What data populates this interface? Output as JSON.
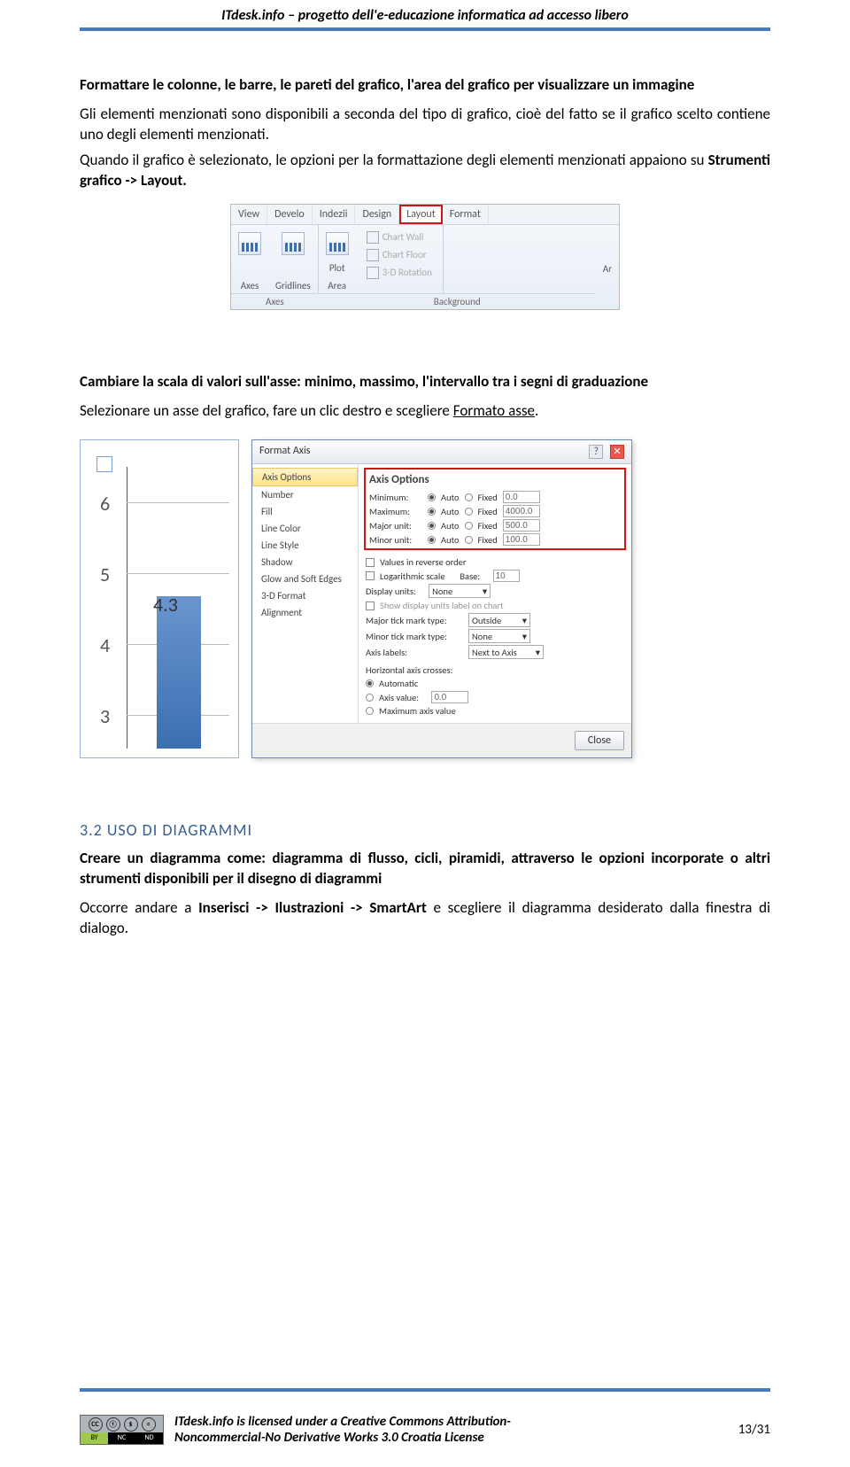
{
  "header": "ITdesk.info – progetto dell'e-educazione informatica ad accesso libero",
  "sec1": {
    "title": "Formattare le colonne, le barre, le pareti del grafico, l'area del grafico per visualizzare un immagine",
    "p1a": "Gli elementi menzionati sono disponibili a seconda del tipo di grafico, cioè del fatto se il grafico scelto contiene uno degli elementi menzionati.",
    "p1b_pre": "Quando il grafico è selezionato, le opzioni per la formattazione degli elementi menzionati appaiono su ",
    "p1b_bold": "Strumenti grafico -> Layout.",
    "ribbon": {
      "tabs": [
        "View",
        "Develo",
        "Indezii",
        "Design",
        "Layout",
        "Format"
      ],
      "g_axes": "Axes",
      "g_grid": "Gridlines",
      "g_plot_t": "Plot",
      "g_plot_b": "Area",
      "bg_wall": "Chart Wall",
      "bg_floor": "Chart Floor",
      "bg_rot": "3-D Rotation",
      "grp_axes": "Axes",
      "grp_bg": "Background",
      "ar": "Ar"
    }
  },
  "sec2": {
    "title": "Cambiare la scala di valori sull'asse: minimo, massimo, l'intervallo tra i segni di graduazione",
    "p1_pre": "Selezionare un asse del grafico, fare un clic destro e scegliere ",
    "p1_u": "Formato asse",
    "p1_post": ".",
    "chart": {
      "ticks": [
        "6",
        "5",
        "4",
        "3"
      ],
      "barlabel": "4.3"
    },
    "dlg": {
      "title": "Format Axis",
      "nav": [
        "Axis Options",
        "Number",
        "Fill",
        "Line Color",
        "Line Style",
        "Shadow",
        "Glow and Soft Edges",
        "3-D Format",
        "Alignment"
      ],
      "ao_title": "Axis Options",
      "rows": [
        {
          "lbl": "Minimum:",
          "auto": "Auto",
          "fixed": "Fixed",
          "val": "0.0"
        },
        {
          "lbl": "Maximum:",
          "auto": "Auto",
          "fixed": "Fixed",
          "val": "4000.0"
        },
        {
          "lbl": "Major unit:",
          "auto": "Auto",
          "fixed": "Fixed",
          "val": "500.0"
        },
        {
          "lbl": "Minor unit:",
          "auto": "Auto",
          "fixed": "Fixed",
          "val": "100.0"
        }
      ],
      "reverse": "Values in reverse order",
      "log": "Logarithmic scale",
      "base": "Base:",
      "base_v": "10",
      "disp": "Display units:",
      "disp_v": "None",
      "show": "Show display units label on chart",
      "majt": "Major tick mark type:",
      "majt_v": "Outside",
      "mint": "Minor tick mark type:",
      "mint_v": "None",
      "axl": "Axis labels:",
      "axl_v": "Next to Axis",
      "cross": "Horizontal axis crosses:",
      "c1": "Automatic",
      "c2": "Axis value:",
      "c2v": "0.0",
      "c3": "Maximum axis value",
      "close": "Close"
    }
  },
  "sec3": {
    "num": "3.2   USO DI DIAGRAMMI",
    "title": "Creare un diagramma come: diagramma di flusso, cicli, piramidi, attraverso le opzioni incorporate o altri strumenti disponibili per il disegno di diagrammi",
    "p_pre": "Occorre andare a ",
    "p_bold": "Inserisci -> Ilustrazioni -> SmartArt",
    "p_post": " e scegliere il diagramma desiderato dalla finestra di dialogo."
  },
  "footer": {
    "l1": "ITdesk.info is licensed under a Creative Commons Attribution-",
    "l2": "Noncommercial-No Derivative Works 3.0 Croatia License",
    "page": "13/31"
  }
}
